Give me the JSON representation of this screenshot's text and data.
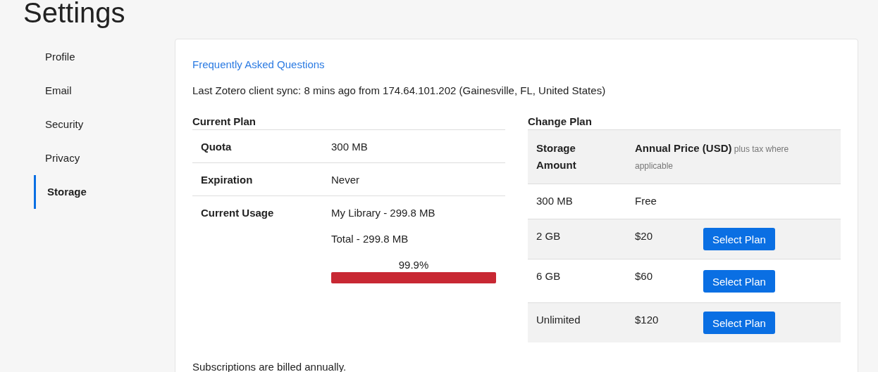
{
  "page_title": "Settings",
  "sidebar": {
    "items": [
      {
        "label": "Profile",
        "selected": false
      },
      {
        "label": "Email",
        "selected": false
      },
      {
        "label": "Security",
        "selected": false
      },
      {
        "label": "Privacy",
        "selected": false
      },
      {
        "label": "Storage",
        "selected": true
      }
    ]
  },
  "faq_link": "Frequently Asked Questions",
  "sync_info": "Last Zotero client sync: 8 mins ago from 174.64.101.202 (Gainesville, FL, United States)",
  "current_plan": {
    "title": "Current Plan",
    "rows": [
      {
        "label": "Quota",
        "values": [
          "300 MB"
        ]
      },
      {
        "label": "Expiration",
        "values": [
          "Never"
        ]
      },
      {
        "label": "Current Usage",
        "values": [
          "My Library - 299.8 MB",
          "Total - 299.8 MB"
        ],
        "usage": {
          "reading": "99.9%",
          "level": 0.999
        }
      }
    ]
  },
  "change_plan": {
    "title": "Change Plan",
    "columns": [
      "Storage Amount",
      "**Annual Price (USD)** plus tax where applicable"
    ],
    "rows": [
      {
        "amount": "300 MB",
        "price": "Free"
      },
      {
        "amount": "2 GB",
        "price": "$20",
        "action": "Select Plan"
      },
      {
        "amount": "6 GB",
        "price": "$60",
        "action": "Select Plan"
      },
      {
        "amount": "Unlimited",
        "price": "$120",
        "action": "Select Plan"
      }
    ]
  },
  "footer_note": "Subscriptions are billed annually."
}
